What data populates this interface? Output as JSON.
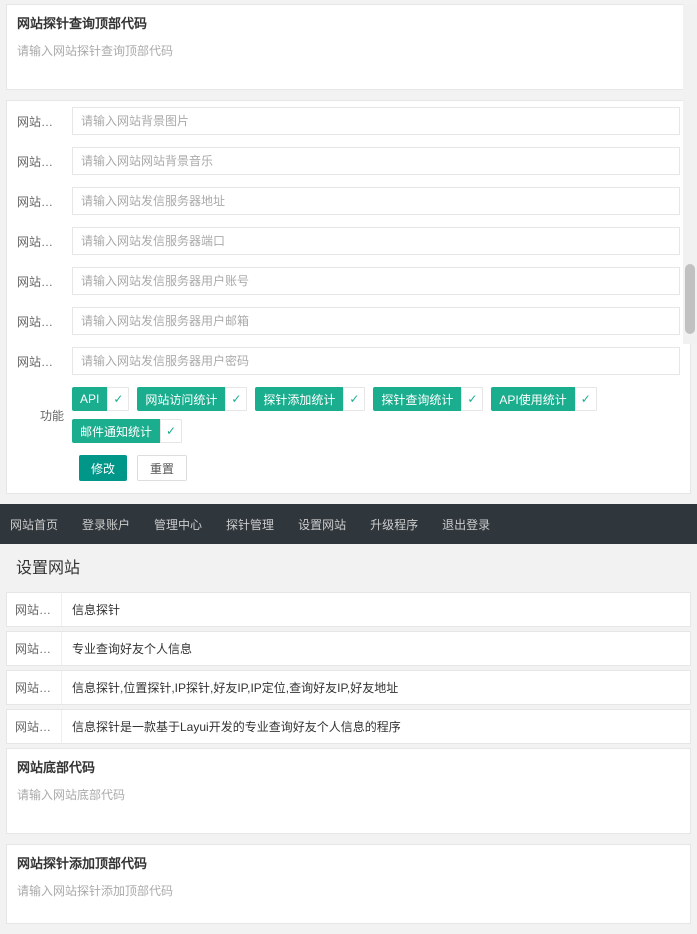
{
  "topTextarea": {
    "title": "网站探针查询顶部代码",
    "placeholder": "请输入网站探针查询顶部代码"
  },
  "fields": [
    {
      "label": "网站背景…",
      "placeholder": "请输入网站背景图片"
    },
    {
      "label": "网站背景…",
      "placeholder": "请输入网站网站背景音乐"
    },
    {
      "label": "网站发信…",
      "placeholder": "请输入网站发信服务器地址"
    },
    {
      "label": "网站发信…",
      "placeholder": "请输入网站发信服务器端口"
    },
    {
      "label": "网站发信…",
      "placeholder": "请输入网站发信服务器用户账号"
    },
    {
      "label": "网站发信…",
      "placeholder": "请输入网站发信服务器用户邮箱"
    },
    {
      "label": "网站发信…",
      "placeholder": "请输入网站发信服务器用户密码"
    }
  ],
  "funcLabel": "功能",
  "funcTags": [
    "API",
    "网站访问统计",
    "探针添加统计",
    "探针查询统计",
    "API使用统计",
    "邮件通知统计"
  ],
  "buttons": {
    "submit": "修改",
    "reset": "重置"
  },
  "nav": [
    "网站首页",
    "登录账户",
    "管理中心",
    "探针管理",
    "设置网站",
    "升级程序",
    "退出登录"
  ],
  "pageTitle": "设置网站",
  "readonlyRows": [
    {
      "label": "网站标题",
      "value": "信息探针"
    },
    {
      "label": "网站副标题",
      "value": "专业查询好友个人信息"
    },
    {
      "label": "网站关键词",
      "value": "信息探针,位置探针,IP探针,好友IP,IP定位,查询好友IP,好友地址"
    },
    {
      "label": "网站描述",
      "value": "信息探针是一款基于Layui开发的专业查询好友个人信息的程序"
    }
  ],
  "bottomTextareas": [
    {
      "title": "网站底部代码",
      "placeholder": "请输入网站底部代码"
    },
    {
      "title": "网站探针添加顶部代码",
      "placeholder": "请输入网站探针添加顶部代码"
    }
  ]
}
